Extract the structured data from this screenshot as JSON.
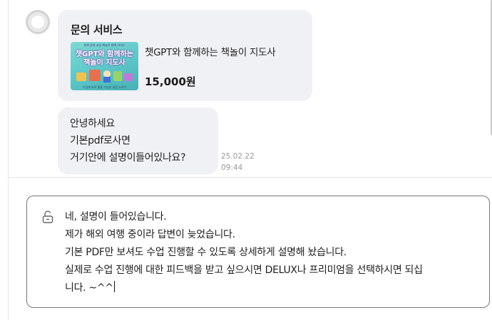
{
  "product_card": {
    "title": "문의 서비스",
    "product_name": "챗GPT와 함께하는 책놀이 지도사",
    "price": "15,000원",
    "thumbnail": {
      "top_text": "동화 동화 교실 책놀이 완벽 가이드",
      "line1": "챗GPT와 함께하는",
      "line2": "책놀이 지도사",
      "footer": "수업에 바로 활용 가능한 실전 노하우"
    }
  },
  "message": {
    "lines": [
      "안녕하세요",
      "기본pdf로사면",
      "거기안에 설명이들어있나요?"
    ],
    "date": "25.02.22",
    "time": "09:44"
  },
  "composer": {
    "lines": [
      "네, 설명이 들어있습니다.",
      "제가 해외 여행 중이라 답변이 늦었습니다.",
      "기본 PDF만 보셔도 수업 진행할 수 있도록 상세하게 설명해 놨습니다.",
      "실제로 수업 진행에 대한 피드백을 받고 싶으시면 DELUX나 프리미엄을 선택하시면 되십",
      "니다. ~^^"
    ],
    "icon": "unlock-icon"
  },
  "colors": {
    "bubble_bg": "#f0f1f4",
    "composer_border": "#777777",
    "timestamp": "#9a9a9a"
  }
}
